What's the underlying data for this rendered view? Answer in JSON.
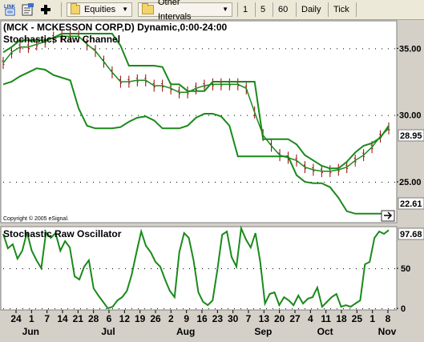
{
  "toolbar": {
    "link_icon": "link-icon",
    "properties_icon": "properties-icon",
    "add_icon": "plus-icon",
    "symbol_list": "Equities",
    "interval_list": "Other Intervals",
    "intervals": [
      "1",
      "5",
      "60",
      "Daily",
      "Tick"
    ]
  },
  "upper_panel": {
    "header": "(MCK - MCKESSON CORP,D) Dynamic,0:00-24:00",
    "study_name": "Stochastics Raw Channel",
    "copyright": "Copyright © 2005 eSignal.",
    "last_price_label": "28.95",
    "channel_low_label": "22.61",
    "y_ticks": [
      "35.00",
      "30.00",
      "25.00"
    ]
  },
  "lower_panel": {
    "study_name": "Stochastic Raw Oscillator",
    "value_label": "97.68",
    "y_ticks": [
      "50",
      "0"
    ]
  },
  "x_axis": {
    "day_ticks": [
      "24",
      "1",
      "7",
      "14",
      "21",
      "28",
      "6",
      "12",
      "19",
      "26",
      "2",
      "9",
      "16",
      "23",
      "30",
      "7",
      "13",
      "20",
      "27",
      "4",
      "11",
      "18",
      "25",
      "1",
      "8"
    ],
    "month_labels": [
      "Jun",
      "Jul",
      "Aug",
      "Sep",
      "Oct",
      "Nov"
    ]
  },
  "colors": {
    "line": "#1a8a1a",
    "bars": "#990000",
    "plot_bg": "#ffffff",
    "label_bg": "#d4d0c8"
  },
  "chart_data": {
    "type": "line",
    "title": "(MCK - MCKESSON CORP,D) Dynamic,0:00-24:00",
    "price_panel": {
      "ylim": [
        22.0,
        37.0
      ],
      "last_price": 28.95,
      "channel_low_last": 22.61,
      "series": [
        {
          "name": "Stochastics Raw Channel",
          "points": [
            [
              0,
              33.9
            ],
            [
              3,
              34.7
            ],
            [
              6,
              35.1
            ],
            [
              9,
              35.1
            ],
            [
              12,
              35.3
            ],
            [
              15,
              35.5
            ],
            [
              18,
              35.8
            ],
            [
              21,
              35.9
            ],
            [
              24,
              35.9
            ],
            [
              27,
              35.9
            ],
            [
              30,
              35.3
            ],
            [
              33,
              34.8
            ],
            [
              36,
              34.0
            ],
            [
              39,
              33.2
            ],
            [
              42,
              32.5
            ],
            [
              45,
              32.5
            ],
            [
              48,
              32.6
            ],
            [
              51,
              32.6
            ],
            [
              54,
              32.2
            ],
            [
              57,
              32.2
            ],
            [
              60,
              32.0
            ],
            [
              63,
              31.7
            ],
            [
              66,
              31.7
            ],
            [
              69,
              32.0
            ],
            [
              72,
              32.2
            ],
            [
              75,
              32.3
            ],
            [
              78,
              32.3
            ],
            [
              81,
              32.3
            ],
            [
              84,
              32.3
            ],
            [
              87,
              32.0
            ],
            [
              90,
              30.2
            ],
            [
              93,
              28.5
            ],
            [
              96,
              27.7
            ],
            [
              99,
              27.0
            ],
            [
              102,
              26.8
            ],
            [
              105,
              26.6
            ],
            [
              108,
              26.1
            ],
            [
              111,
              25.9
            ],
            [
              114,
              25.8
            ],
            [
              117,
              25.8
            ],
            [
              120,
              25.9
            ],
            [
              123,
              26.1
            ],
            [
              126,
              26.6
            ],
            [
              129,
              27.0
            ],
            [
              132,
              27.6
            ],
            [
              135,
              28.4
            ],
            [
              138,
              29.0
            ]
          ]
        },
        {
          "name": "Channel Low",
          "points": [
            [
              0,
              32.3
            ],
            [
              3,
              32.5
            ],
            [
              6,
              32.9
            ],
            [
              9,
              33.2
            ],
            [
              12,
              33.5
            ],
            [
              15,
              33.4
            ],
            [
              18,
              33.0
            ],
            [
              21,
              32.8
            ],
            [
              24,
              32.6
            ],
            [
              27,
              30.5
            ],
            [
              30,
              29.2
            ],
            [
              33,
              29.0
            ],
            [
              36,
              29.0
            ],
            [
              39,
              29.0
            ],
            [
              42,
              29.1
            ],
            [
              45,
              29.5
            ],
            [
              48,
              29.8
            ],
            [
              51,
              29.9
            ],
            [
              54,
              29.6
            ],
            [
              57,
              29.0
            ],
            [
              60,
              29.0
            ],
            [
              63,
              29.0
            ],
            [
              66,
              29.2
            ],
            [
              69,
              29.8
            ],
            [
              72,
              30.1
            ],
            [
              75,
              30.1
            ],
            [
              78,
              29.9
            ],
            [
              81,
              29.2
            ],
            [
              84,
              26.9
            ],
            [
              87,
              26.9
            ],
            [
              90,
              26.9
            ],
            [
              93,
              26.9
            ],
            [
              96,
              26.9
            ],
            [
              99,
              26.9
            ],
            [
              102,
              26.9
            ],
            [
              105,
              25.5
            ],
            [
              108,
              25.0
            ],
            [
              111,
              24.9
            ],
            [
              114,
              24.9
            ],
            [
              117,
              24.6
            ],
            [
              120,
              23.8
            ],
            [
              123,
              22.8
            ],
            [
              126,
              22.61
            ],
            [
              129,
              22.61
            ],
            [
              132,
              22.61
            ],
            [
              135,
              22.61
            ],
            [
              138,
              22.61
            ]
          ]
        },
        {
          "name": "Channel High",
          "points": [
            [
              0,
              34.7
            ],
            [
              3,
              35.1
            ],
            [
              6,
              35.6
            ],
            [
              9,
              35.6
            ],
            [
              12,
              35.6
            ],
            [
              15,
              35.6
            ],
            [
              18,
              35.8
            ],
            [
              21,
              36.1
            ],
            [
              24,
              36.1
            ],
            [
              27,
              36.1
            ],
            [
              30,
              36.1
            ],
            [
              33,
              36.1
            ],
            [
              36,
              36.1
            ],
            [
              39,
              36.1
            ],
            [
              42,
              35.2
            ],
            [
              45,
              33.7
            ],
            [
              48,
              33.7
            ],
            [
              51,
              33.7
            ],
            [
              54,
              33.7
            ],
            [
              57,
              33.6
            ],
            [
              60,
              32.3
            ],
            [
              63,
              32.3
            ],
            [
              66,
              31.8
            ],
            [
              69,
              31.8
            ],
            [
              72,
              31.8
            ],
            [
              75,
              32.5
            ],
            [
              78,
              32.5
            ],
            [
              81,
              32.5
            ],
            [
              84,
              32.5
            ],
            [
              87,
              32.5
            ],
            [
              90,
              32.5
            ],
            [
              93,
              28.2
            ],
            [
              96,
              28.2
            ],
            [
              99,
              28.2
            ],
            [
              102,
              28.2
            ],
            [
              105,
              27.8
            ],
            [
              108,
              27.0
            ],
            [
              111,
              26.6
            ],
            [
              114,
              26.2
            ],
            [
              117,
              26.0
            ],
            [
              120,
              26.0
            ],
            [
              123,
              26.5
            ],
            [
              126,
              27.2
            ],
            [
              129,
              27.7
            ],
            [
              132,
              27.9
            ],
            [
              135,
              28.3
            ],
            [
              138,
              29.2
            ]
          ]
        }
      ]
    },
    "oscillator_panel": {
      "ylim": [
        0,
        100
      ],
      "last_value": 97.68,
      "series": [
        {
          "name": "Stochastic Raw Oscillator",
          "values": [
            93,
            75,
            80,
            62,
            72,
            95,
            72,
            60,
            50,
            95,
            88,
            94,
            72,
            84,
            76,
            40,
            36,
            52,
            60,
            25,
            16,
            8,
            0,
            2,
            10,
            14,
            22,
            42,
            70,
            96,
            78,
            70,
            58,
            52,
            36,
            22,
            14,
            70,
            94,
            88,
            60,
            20,
            8,
            4,
            10,
            48,
            92,
            96,
            64,
            52,
            100,
            86,
            76,
            94,
            58,
            6,
            18,
            20,
            4,
            14,
            10,
            4,
            16,
            6,
            12,
            14,
            26,
            2,
            8,
            14,
            18,
            2,
            4,
            2,
            6,
            10,
            55,
            58,
            88,
            96,
            93,
            97.68
          ]
        }
      ]
    },
    "xlabel": "",
    "ylabel": ""
  }
}
